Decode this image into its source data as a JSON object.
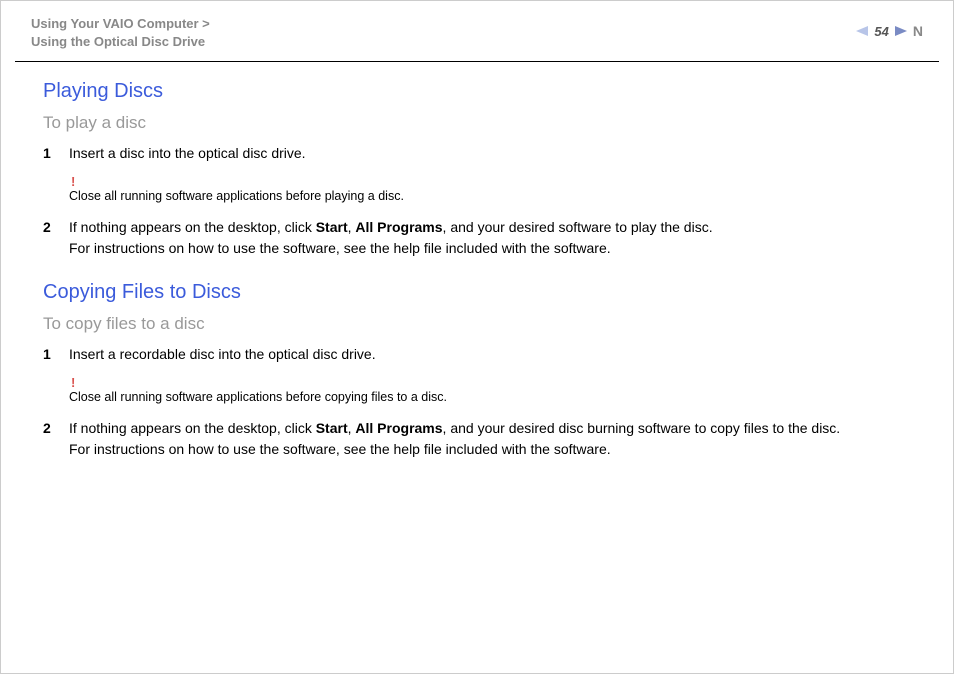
{
  "header": {
    "breadcrumb_line1": "Using Your VAIO Computer >",
    "breadcrumb_line2": "Using the Optical Disc Drive",
    "page_number": "54",
    "N": "N"
  },
  "section1": {
    "heading": "Playing Discs",
    "sub_heading": "To play a disc",
    "step1_num": "1",
    "step1_text": "Insert a disc into the optical disc drive.",
    "note_icon": "!",
    "note_text": "Close all running software applications before playing a disc.",
    "step2_num": "2",
    "step2_pre": "If nothing appears on the desktop, click ",
    "step2_b1": "Start",
    "step2_mid1": ", ",
    "step2_b2": "All Programs",
    "step2_post": ", and your desired software to play the disc.",
    "step2_line2": "For instructions on how to use the software, see the help file included with the software."
  },
  "section2": {
    "heading": "Copying Files to Discs",
    "sub_heading": "To copy files to a disc",
    "step1_num": "1",
    "step1_text": "Insert a recordable disc into the optical disc drive.",
    "note_icon": "!",
    "note_text": "Close all running software applications before copying files to a disc.",
    "step2_num": "2",
    "step2_pre": "If nothing appears on the desktop, click ",
    "step2_b1": "Start",
    "step2_mid1": ", ",
    "step2_b2": "All Programs",
    "step2_post": ", and your desired disc burning software to copy files to the disc.",
    "step2_line2": "For instructions on how to use the software, see the help file included with the software."
  }
}
